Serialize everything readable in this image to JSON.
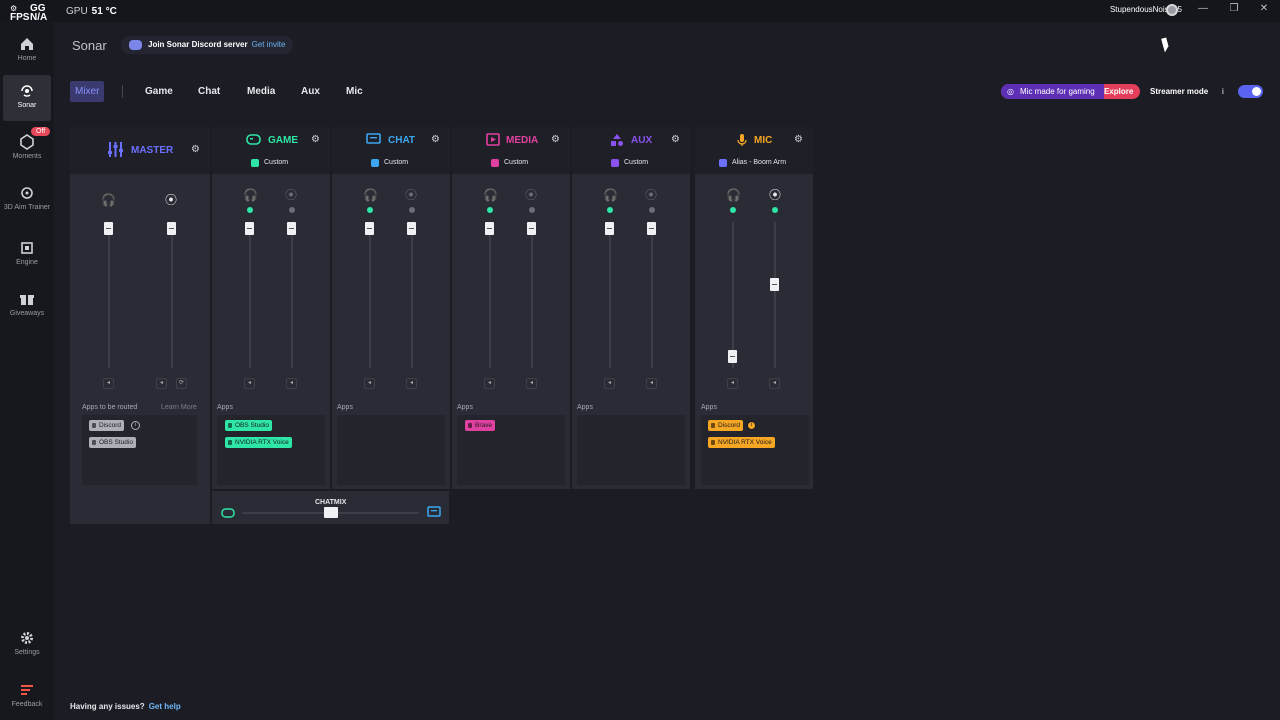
{
  "overlay": {
    "fps_label": "FPS",
    "gg_label": "GG",
    "gg_value": "N/A",
    "gpu_label": "GPU",
    "gpu_value": "51 °C"
  },
  "window": {
    "username": "StupendousNoise95"
  },
  "sidebar": {
    "items": [
      {
        "label": "Home",
        "icon": "home-icon"
      },
      {
        "label": "Sonar",
        "icon": "sonar-icon"
      },
      {
        "label": "Moments",
        "icon": "moments-icon",
        "badge": "Off"
      },
      {
        "label": "3D Aim Trainer",
        "icon": "aim-icon"
      },
      {
        "label": "Engine",
        "icon": "engine-icon"
      },
      {
        "label": "Giveaways",
        "icon": "gift-icon"
      },
      {
        "label": "Settings",
        "icon": "gear-icon"
      },
      {
        "label": "Feedback",
        "icon": "feedback-icon"
      }
    ]
  },
  "header": {
    "title": "Sonar",
    "discord_text": "Join Sonar Discord server",
    "discord_link": "Get invite"
  },
  "tabs": [
    "Mixer",
    "Game",
    "Chat",
    "Media",
    "Aux",
    "Mic"
  ],
  "promo": {
    "text": "Mic made for gaming",
    "link": "Explore"
  },
  "streamer_mode": {
    "label": "Streamer mode",
    "info": "i",
    "enabled": true
  },
  "channels": {
    "master": {
      "name": "MASTER",
      "apps_label": "Apps to be routed",
      "learn_more": "Learn More",
      "apps": [
        "Discord",
        "OBS Studio"
      ]
    },
    "game": {
      "name": "GAME",
      "preset": "Custom",
      "apps_label": "Apps",
      "apps": [
        "OBS Studio",
        "NVIDIA RTX Voice"
      ]
    },
    "chat": {
      "name": "CHAT",
      "preset": "Custom",
      "apps_label": "Apps",
      "apps": []
    },
    "media": {
      "name": "MEDIA",
      "preset": "Custom",
      "apps_label": "Apps",
      "apps": [
        "Brave"
      ]
    },
    "aux": {
      "name": "AUX",
      "preset": "Custom",
      "apps_label": "Apps",
      "apps": []
    },
    "mic": {
      "name": "MIC",
      "preset": "Alias - Boom Arm",
      "apps_label": "Apps",
      "apps": [
        "Discord",
        "NVIDIA RTX Voice"
      ]
    }
  },
  "colors": {
    "game": "#2ee6a6",
    "chat": "#3ca6f0",
    "media": "#e040a0",
    "aux": "#8a52ef",
    "mic": "#f5a623",
    "master": "#6b70ff"
  },
  "levels": {
    "master": {
      "personal": 1.0,
      "stream": 1.0
    },
    "mic": {
      "personal": 0.1,
      "stream": 0.6
    }
  },
  "chatmix": {
    "label": "CHATMIX",
    "balance": 0.5
  },
  "footer": {
    "text": "Having any issues?",
    "link": "Get help"
  }
}
